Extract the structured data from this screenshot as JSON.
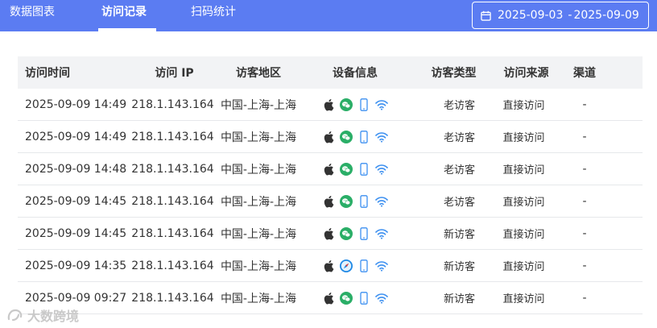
{
  "tabs": [
    {
      "label": "数据图表"
    },
    {
      "label": "访问记录"
    },
    {
      "label": "扫码统计"
    }
  ],
  "active_tab": "访问记录",
  "date_range": {
    "start": "2025-09-03",
    "separator": "-",
    "end": "2025-09-09"
  },
  "table": {
    "headers": {
      "time": "访问时间",
      "ip": "访问 IP",
      "region": "访客地区",
      "device": "设备信息",
      "type": "访客类型",
      "source": "访问来源",
      "channel": "渠道"
    },
    "rows": [
      {
        "time": "2025-09-09 14:49",
        "ip": "218.1.143.164",
        "region": "中国-上海-上海",
        "device_icons": [
          "apple-icon",
          "wechat-icon",
          "phone-icon",
          "wifi-icon"
        ],
        "type": "老访客",
        "source": "直接访问",
        "channel": "-"
      },
      {
        "time": "2025-09-09 14:49",
        "ip": "218.1.143.164",
        "region": "中国-上海-上海",
        "device_icons": [
          "apple-icon",
          "wechat-icon",
          "phone-icon",
          "wifi-icon"
        ],
        "type": "老访客",
        "source": "直接访问",
        "channel": "-"
      },
      {
        "time": "2025-09-09 14:48",
        "ip": "218.1.143.164",
        "region": "中国-上海-上海",
        "device_icons": [
          "apple-icon",
          "wechat-icon",
          "phone-icon",
          "wifi-icon"
        ],
        "type": "老访客",
        "source": "直接访问",
        "channel": "-"
      },
      {
        "time": "2025-09-09 14:45",
        "ip": "218.1.143.164",
        "region": "中国-上海-上海",
        "device_icons": [
          "apple-icon",
          "wechat-icon",
          "phone-icon",
          "wifi-icon"
        ],
        "type": "老访客",
        "source": "直接访问",
        "channel": "-"
      },
      {
        "time": "2025-09-09 14:45",
        "ip": "218.1.143.164",
        "region": "中国-上海-上海",
        "device_icons": [
          "apple-icon",
          "wechat-icon",
          "phone-icon",
          "wifi-icon"
        ],
        "type": "新访客",
        "source": "直接访问",
        "channel": "-"
      },
      {
        "time": "2025-09-09 14:35",
        "ip": "218.1.143.164",
        "region": "中国-上海-上海",
        "device_icons": [
          "apple-icon",
          "safari-icon",
          "phone-icon",
          "wifi-icon"
        ],
        "type": "新访客",
        "source": "直接访问",
        "channel": "-"
      },
      {
        "time": "2025-09-09 09:27",
        "ip": "218.1.143.164",
        "region": "中国-上海-上海",
        "device_icons": [
          "apple-icon",
          "wechat-icon",
          "phone-icon",
          "wifi-icon"
        ],
        "type": "新访客",
        "source": "直接访问",
        "channel": "-"
      }
    ]
  },
  "watermark": {
    "text": "大数跨境"
  },
  "colors": {
    "topbar": "#5b7cf2",
    "wechat": "#2aae67",
    "safari": "#1e88e5",
    "phone": "#3b8ff0",
    "wifi": "#3b8ff0",
    "apple": "#333333"
  }
}
